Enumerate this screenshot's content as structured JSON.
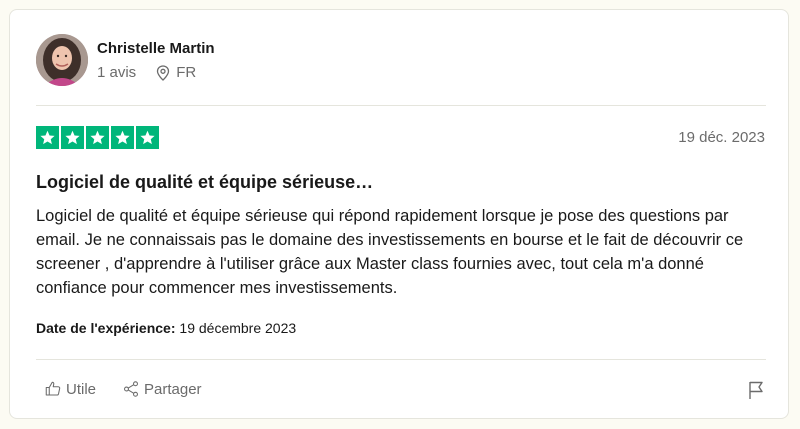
{
  "reviewer": {
    "name": "Christelle Martin",
    "review_count": "1 avis",
    "country": "FR",
    "avatar_icon": "avatar-photo"
  },
  "review": {
    "rating": 5,
    "rating_max": 5,
    "star_color": "#00b67a",
    "date": "19 déc. 2023",
    "title": "Logiciel de qualité et équipe sérieuse…",
    "body": "Logiciel de qualité et équipe sérieuse qui répond rapidement lorsque je pose des questions par email. Je ne connaissais pas le domaine des investissements en bourse et le fait de découvrir ce screener , d'apprendre à l'utiliser grâce aux Master class fournies avec, tout cela m'a donné confiance pour commencer mes investissements.",
    "experience_label": "Date de l'expérience:",
    "experience_date": "19 décembre 2023"
  },
  "actions": {
    "useful_label": "Utile",
    "useful_icon": "thumbs-up-icon",
    "share_label": "Partager",
    "share_icon": "share-icon",
    "report_icon": "flag-icon"
  }
}
